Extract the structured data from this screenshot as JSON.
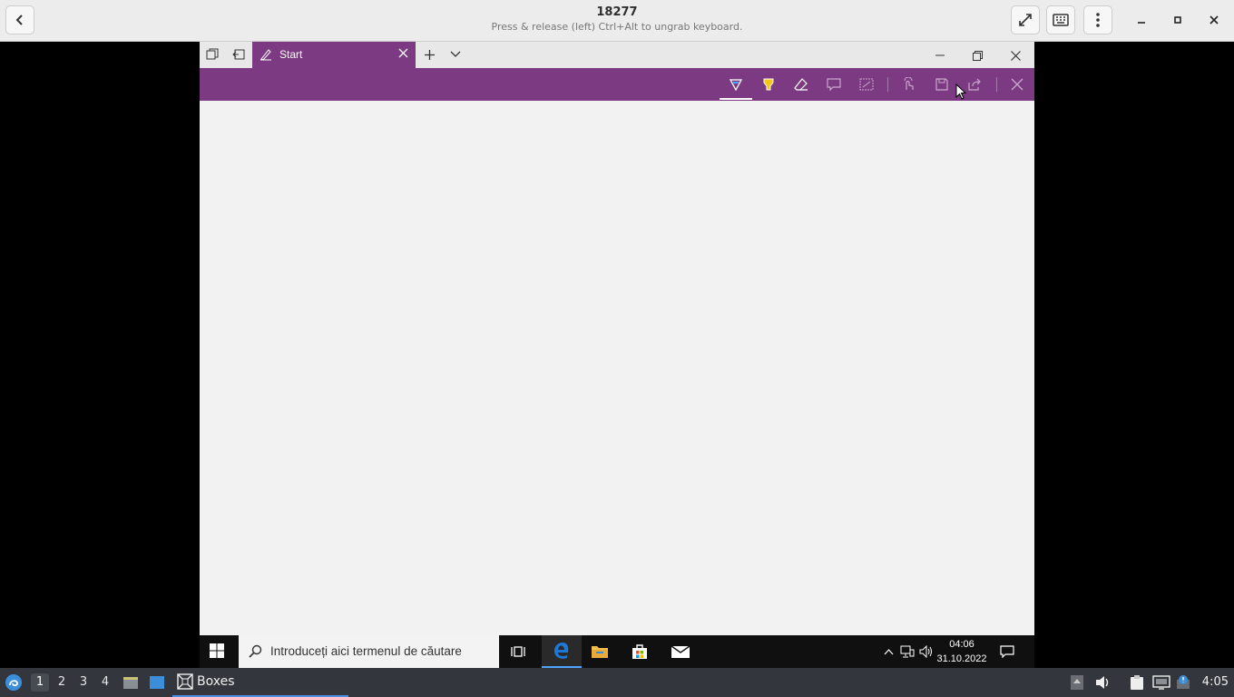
{
  "boxes": {
    "title": "18277",
    "subtitle": "Press & release (left) Ctrl+Alt to ungrab keyboard."
  },
  "vm_app": {
    "tab_label": "Start",
    "accent_color": "#7c3a82"
  },
  "win_taskbar": {
    "search_placeholder": "Introduceți aici termenul de căutare",
    "clock_time": "04:06",
    "clock_date": "31.10.2022"
  },
  "host_panel": {
    "workspaces": [
      "1",
      "2",
      "3",
      "4"
    ],
    "task_label": "Boxes",
    "time": "4:05"
  }
}
